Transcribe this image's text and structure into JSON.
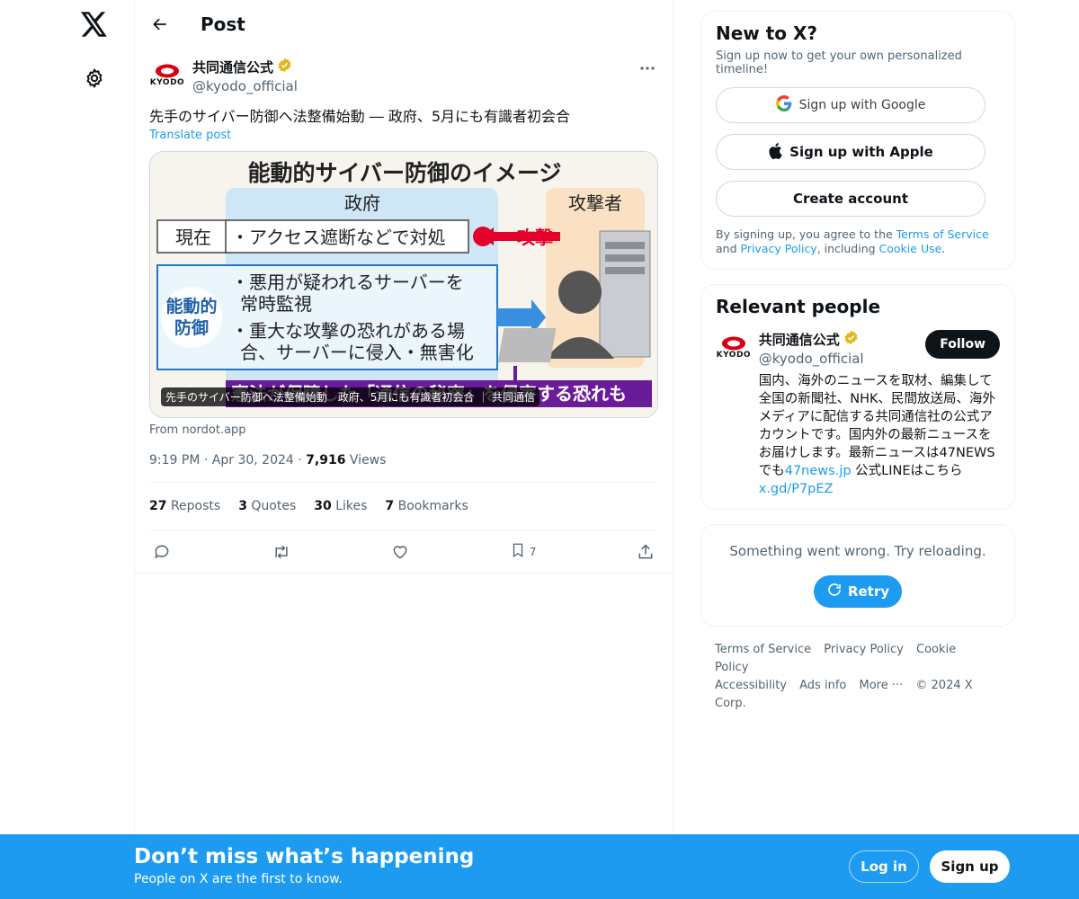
{
  "nav": {
    "logo_icon": "x-logo-icon",
    "settings_icon": "gear-icon"
  },
  "header": {
    "title": "Post"
  },
  "post": {
    "author_name": "共同通信公式",
    "author_handle": "@kyodo_official",
    "avatar_text": "KYODO",
    "text": "先手のサイバー防御へ法整備始動 ― 政府、5月にも有識者初会合",
    "translate": "Translate post",
    "card": {
      "image_title": "能動的サイバー防御のイメージ",
      "label_government": "政府",
      "label_attacker": "攻撃者",
      "label_current": "現在",
      "current_text": "・アクセス遮断などで対処",
      "attack_label": "攻撃",
      "label_active": "能動的\n防御",
      "active_line1": "・悪用が疑われるサーバーを\n常時監視",
      "active_line2": "・重大な攻撃の恐れがある場\n合、サーバーに侵入・無害化",
      "bottom_banner": "憲法が保障した「通信の秘密」を侵害する恐れも",
      "caption": "先手のサイバー防御へ法整備始動　政府、5月にも有識者初会合 ｜ 共同通信"
    },
    "source": "From nordot.app",
    "time": "9:19 PM",
    "date": "Apr 30, 2024",
    "views_count": "7,916",
    "views_label": "Views",
    "reposts_count": "27",
    "reposts_label": "Reposts",
    "quotes_count": "3",
    "quotes_label": "Quotes",
    "likes_count": "30",
    "likes_label": "Likes",
    "bookmarks_count": "7",
    "bookmarks_label": "Bookmarks",
    "bookmark_action_count": "7"
  },
  "signup_box": {
    "title": "New to X?",
    "subtitle": "Sign up now to get your own personalized timeline!",
    "google": "Sign up with Google",
    "apple": "Sign up with Apple",
    "create": "Create account",
    "legal_1": "By signing up, you agree to the ",
    "terms": "Terms of Service",
    "legal_2": " and ",
    "privacy": "Privacy Policy",
    "legal_3": ", including ",
    "cookie": "Cookie Use",
    "legal_4": "."
  },
  "relevant": {
    "title": "Relevant people",
    "name": "共同通信公式",
    "handle": "@kyodo_official",
    "follow": "Follow",
    "bio_1": "国内、海外のニュースを取材、編集して全国の新聞社、NHK、民間放送局、海外メディアに配信する共同通信社の公式アカウントです。国内外の最新ニュースをお届けします。最新ニュースは47NEWSでも",
    "bio_link1": "47news.jp",
    "bio_2": " 公式LINEはこちら",
    "bio_link2": "x.gd/P7pEZ"
  },
  "error_box": {
    "text": "Something went wrong. Try reloading.",
    "retry": "Retry"
  },
  "footer": {
    "terms": "Terms of Service",
    "privacy": "Privacy Policy",
    "cookie": "Cookie Policy",
    "accessibility": "Accessibility",
    "ads": "Ads info",
    "more": "More ···",
    "copyright": "© 2024 X Corp."
  },
  "bottom_bar": {
    "title": "Don’t miss what’s happening",
    "subtitle": "People on X are the first to know.",
    "login": "Log in",
    "signup": "Sign up"
  },
  "colors": {
    "accent": "#1d9bf0",
    "text": "#0f1419",
    "muted": "#536471",
    "verified": "#e2b719",
    "kyodo_red": "#d7000f"
  }
}
